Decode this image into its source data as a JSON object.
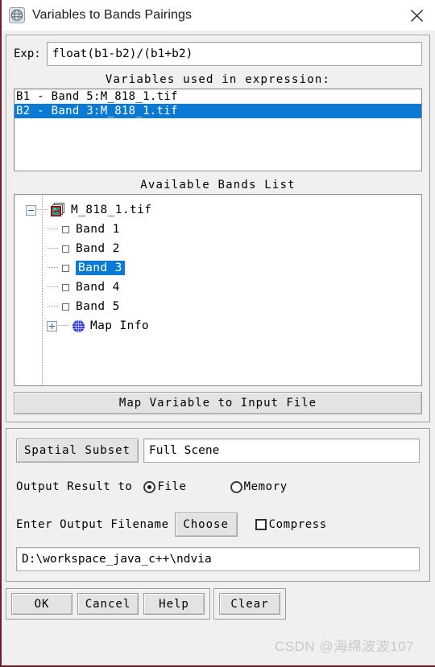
{
  "window": {
    "title": "Variables to Bands Pairings",
    "app_icon": "globe-app-icon",
    "close_icon": "close-icon"
  },
  "expression": {
    "label": "Exp:",
    "value": "float(b1-b2)/(b1+b2)",
    "placeholder": ""
  },
  "variables_section": {
    "title": "Variables used in expression:",
    "items": [
      {
        "text": "B1 - Band 5:M_818_1.tif",
        "selected": false
      },
      {
        "text": "B2 - Band 3:M_818_1.tif",
        "selected": true
      }
    ]
  },
  "bands_section": {
    "title": "Available Bands List",
    "tree": {
      "root": {
        "label": "M_818_1.tif",
        "expander": "minus",
        "icon": "layers-file-icon"
      },
      "bands": [
        {
          "label": "Band 1",
          "icon": "band-checkbox-icon",
          "selected": false
        },
        {
          "label": "Band 2",
          "icon": "band-checkbox-icon",
          "selected": false
        },
        {
          "label": "Band 3",
          "icon": "band-checkbox-icon",
          "selected": true
        },
        {
          "label": "Band 4",
          "icon": "band-checkbox-icon",
          "selected": false
        },
        {
          "label": "Band 5",
          "icon": "band-checkbox-icon",
          "selected": false
        }
      ],
      "map_info": {
        "label": "Map Info",
        "expander": "plus",
        "icon": "globe-icon"
      }
    },
    "map_variable_button": "Map Variable to Input File"
  },
  "output_section": {
    "spatial_subset_button": "Spatial Subset",
    "scene_value": "Full Scene",
    "output_result_label": "Output Result to",
    "radio_options": [
      {
        "label": "File",
        "checked": true
      },
      {
        "label": "Memory",
        "checked": false
      }
    ],
    "filename_label": "Enter Output Filename",
    "choose_button": "Choose",
    "compress_label": "Compress",
    "compress_checked": false,
    "output_path": "D:\\workspace_java_c++\\ndvia"
  },
  "buttons": {
    "primary_group": [
      "OK",
      "Cancel",
      "Help"
    ],
    "secondary_group": [
      "Clear"
    ]
  },
  "watermark": "CSDN @海绵波波107",
  "colors": {
    "selection_blue": "#0b7ad5",
    "dialog_bg": "#f0f0f0",
    "field_bg": "#ffffff",
    "window_edge": "#6b1f2a"
  }
}
